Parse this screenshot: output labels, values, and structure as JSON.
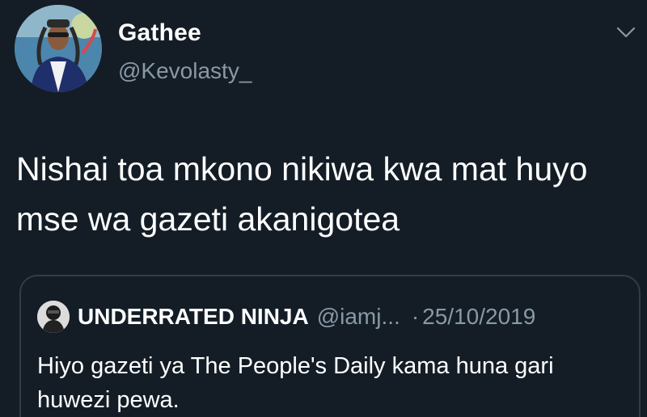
{
  "author": {
    "display_name": "Gathee",
    "handle": "@Kevolasty_",
    "avatar_icon": "user-avatar-photo"
  },
  "menu_icon": "chevron-down-icon",
  "tweet": {
    "text": "Nishai toa mkono nikiwa kwa mat huyo\nmse wa gazeti akanigotea"
  },
  "quoted_tweet": {
    "display_name": "UNDERRATED NINJA",
    "handle": "@iamj...",
    "separator": "·",
    "date": "25/10/2019",
    "text": "Hiyo gazeti ya The People's Daily kama huna gari huwezi pewa.",
    "avatar_icon": "quoted-user-avatar-photo"
  },
  "colors": {
    "background": "#141d26",
    "primary_text": "#ffffff",
    "secondary_text": "#8899a6",
    "card_border": "#2f3d4b"
  }
}
